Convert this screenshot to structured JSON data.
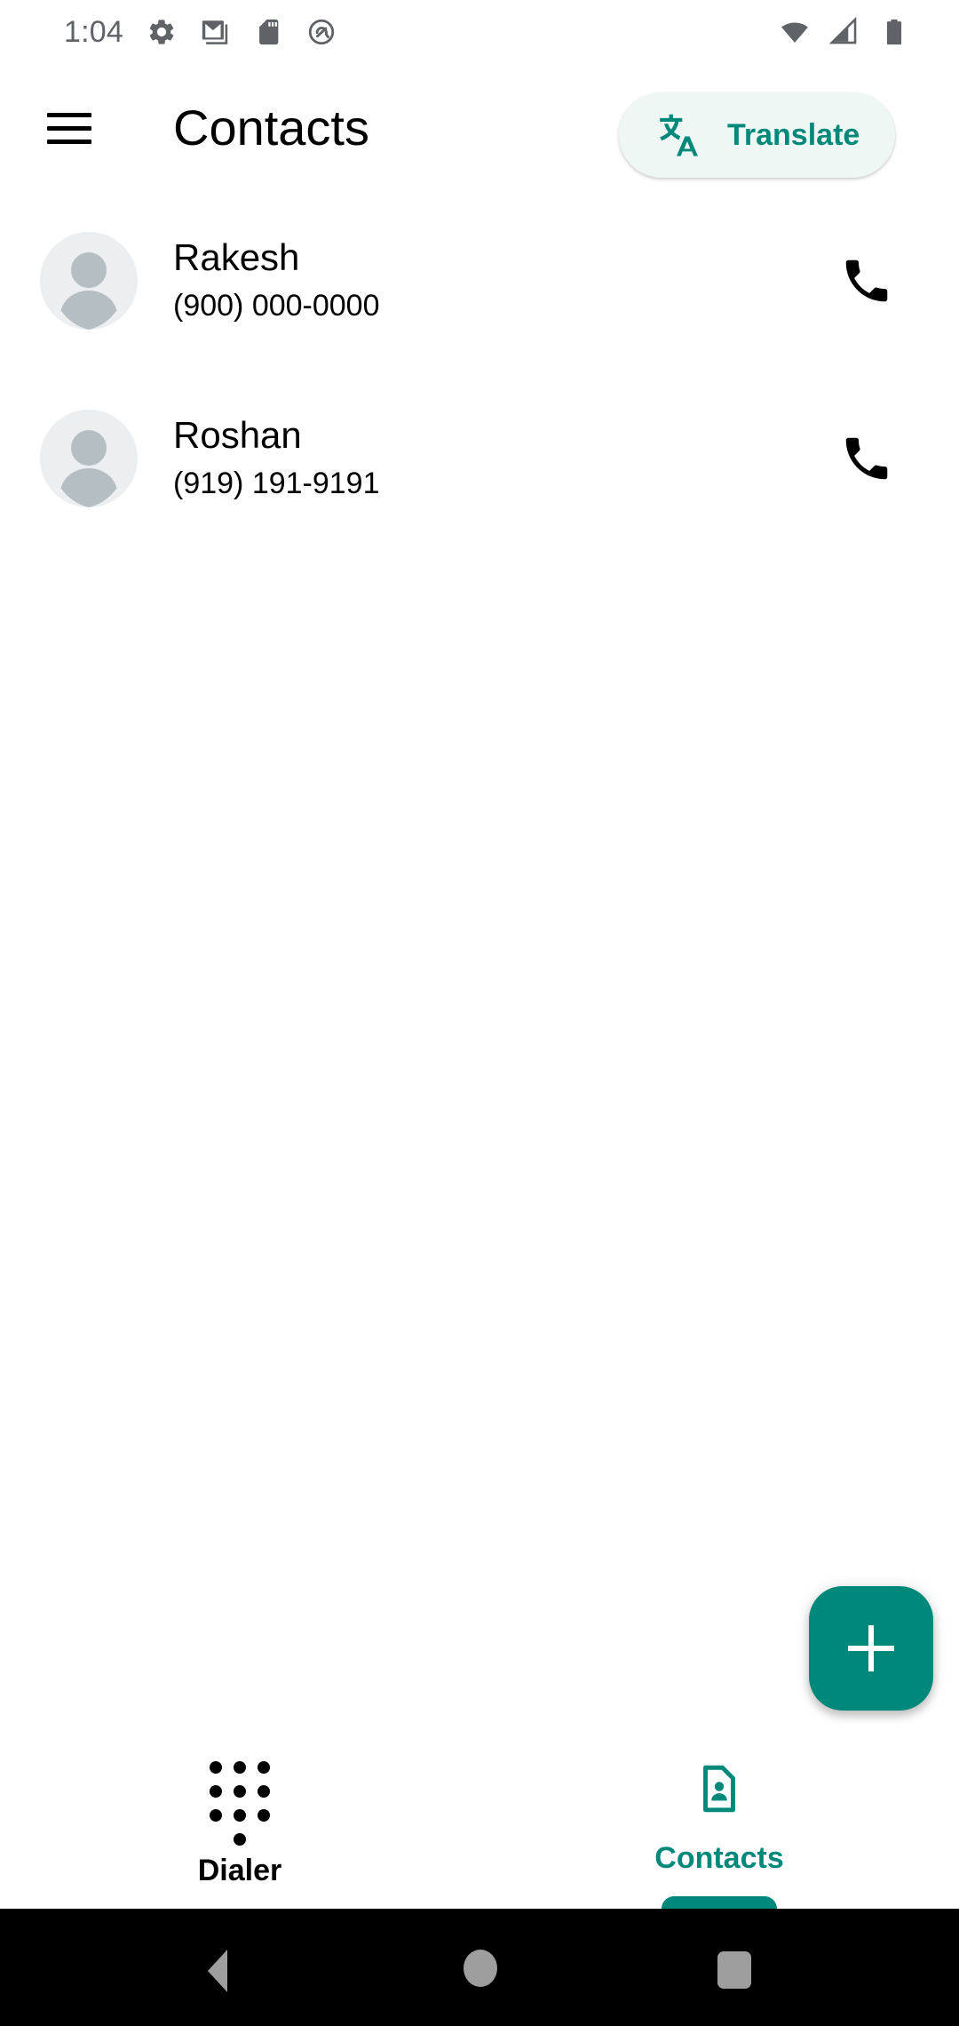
{
  "status_bar": {
    "time": "1:04",
    "left_icons": [
      "gear-icon",
      "gmail-icon",
      "sd-card-icon",
      "android-q-icon"
    ],
    "right_icons": [
      "wifi-icon",
      "cellular-signal-icon",
      "battery-icon"
    ]
  },
  "app_bar": {
    "title": "Contacts",
    "menu_icon": "hamburger-menu-icon",
    "translate": {
      "label": "Translate",
      "icon": "translate-icon",
      "text_color": "#00887a",
      "background_color": "#eff7f4"
    }
  },
  "contacts": [
    {
      "name": "Rakesh",
      "phone": "(900) 000-0000",
      "avatar": "default-person-avatar",
      "call_icon": "phone-icon"
    },
    {
      "name": "Roshan",
      "phone": "(919) 191-9191",
      "avatar": "default-person-avatar",
      "call_icon": "phone-icon"
    }
  ],
  "fab": {
    "icon": "plus-icon",
    "color": "#00897b"
  },
  "bottom_nav": {
    "tabs": [
      {
        "label": "Dialer",
        "icon": "dialpad-icon",
        "active": false
      },
      {
        "label": "Contacts",
        "icon": "contact-page-icon",
        "active": true
      }
    ],
    "active_color": "#00887a",
    "inactive_color": "#000000"
  },
  "system_nav": {
    "buttons": [
      "back-button",
      "home-button",
      "recents-button"
    ]
  }
}
